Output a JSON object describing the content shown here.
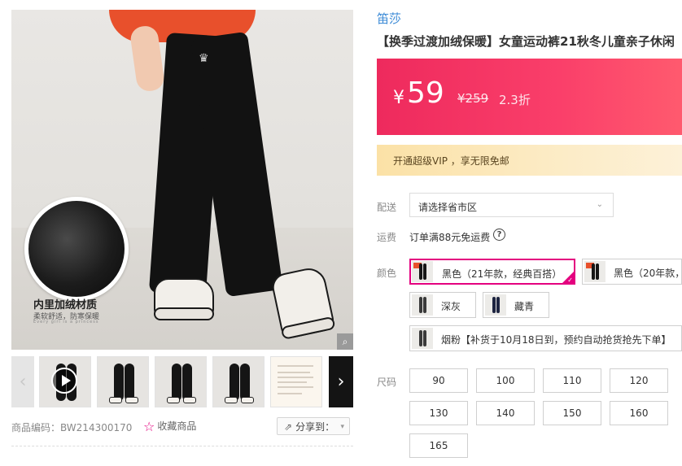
{
  "gallery": {
    "feature_title": "内里加绒材质",
    "feature_subtitle": "柔软舒适，防寒保暖",
    "feature_tagline": "Every girl is a princess",
    "zoom_icon": "magnifier-icon",
    "prev_arrow": "‹",
    "next_arrow": "›"
  },
  "meta": {
    "product_code": "商品编码：BW214300170",
    "favorite_label": "收藏商品",
    "share_label": "分享到："
  },
  "product": {
    "brand": "笛莎",
    "title": "【换季过渡加绒保暖】女童运动裤21秋冬儿童亲子休闲",
    "price_symbol": "¥",
    "price": "59",
    "original_price": "¥259",
    "discount": "2.3折"
  },
  "vip": {
    "text": "开通超级VIP ，享无限免邮"
  },
  "delivery": {
    "label": "配送",
    "placeholder": "请选择省市区"
  },
  "shipping": {
    "label": "运费",
    "text": "订单满88元免运费",
    "help_icon": "?"
  },
  "colors": {
    "label": "颜色",
    "options": [
      {
        "name": "黑色（21年款，经典百搭）",
        "selected": true
      },
      {
        "name": "黑色（20年款，",
        "selected": false
      },
      {
        "name": "深灰",
        "selected": false
      },
      {
        "name": "藏青",
        "selected": false
      },
      {
        "name": "烟粉【补货于10月18日到，预约自动抢货抢先下单】",
        "selected": false
      }
    ]
  },
  "sizes": {
    "label": "尺码",
    "options": [
      "90",
      "100",
      "110",
      "120",
      "130",
      "140",
      "150",
      "160",
      "165"
    ]
  },
  "colors_theme": {
    "accent": "#e4007f",
    "price_bg": "#f3305f",
    "brand_link": "#3b8ad6"
  }
}
